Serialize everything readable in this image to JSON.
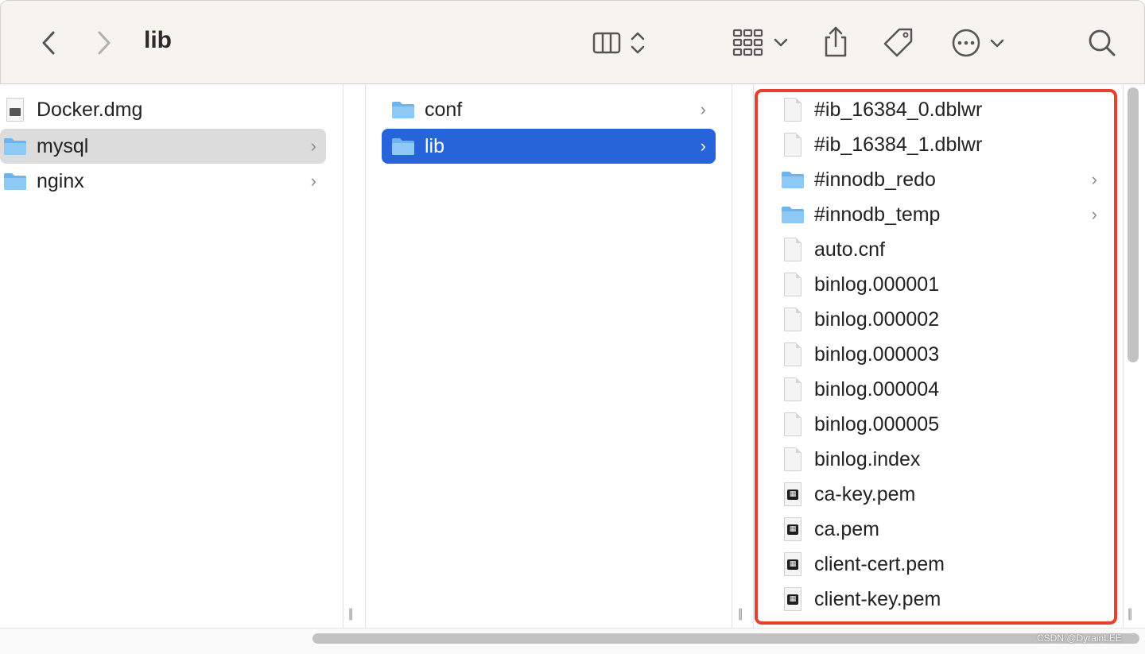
{
  "toolbar": {
    "title": "lib",
    "back_icon": "chevron-left-icon",
    "forward_icon": "chevron-right-icon",
    "view_icon": "columns-view-icon",
    "group_icon": "grid-group-icon",
    "share_icon": "share-icon",
    "tag_icon": "tag-icon",
    "more_icon": "ellipsis-circle-icon",
    "search_icon": "search-icon"
  },
  "column1": {
    "items": [
      {
        "label": "Docker.dmg",
        "type": "dmg"
      },
      {
        "label": "mysql",
        "type": "folder"
      },
      {
        "label": "nginx",
        "type": "folder"
      }
    ]
  },
  "column2": {
    "items": [
      {
        "label": "conf",
        "type": "folder"
      },
      {
        "label": "lib",
        "type": "folder"
      }
    ]
  },
  "column3": {
    "items": [
      {
        "label": "#ib_16384_0.dblwr",
        "type": "doc"
      },
      {
        "label": "#ib_16384_1.dblwr",
        "type": "doc"
      },
      {
        "label": "#innodb_redo",
        "type": "folder"
      },
      {
        "label": "#innodb_temp",
        "type": "folder"
      },
      {
        "label": "auto.cnf",
        "type": "doc"
      },
      {
        "label": "binlog.000001",
        "type": "doc"
      },
      {
        "label": "binlog.000002",
        "type": "doc"
      },
      {
        "label": "binlog.000003",
        "type": "doc"
      },
      {
        "label": "binlog.000004",
        "type": "doc"
      },
      {
        "label": "binlog.000005",
        "type": "doc"
      },
      {
        "label": "binlog.index",
        "type": "doc"
      },
      {
        "label": "ca-key.pem",
        "type": "pem"
      },
      {
        "label": "ca.pem",
        "type": "pem"
      },
      {
        "label": "client-cert.pem",
        "type": "pem"
      },
      {
        "label": "client-key.pem",
        "type": "pem"
      }
    ]
  },
  "watermark": "CSDN @DyrainLEE",
  "colors": {
    "selection_blue": "#2764d9",
    "selection_grey": "#dcdcdc",
    "highlight_red": "#e8412b",
    "folder_blue": "#6cb4ee"
  }
}
